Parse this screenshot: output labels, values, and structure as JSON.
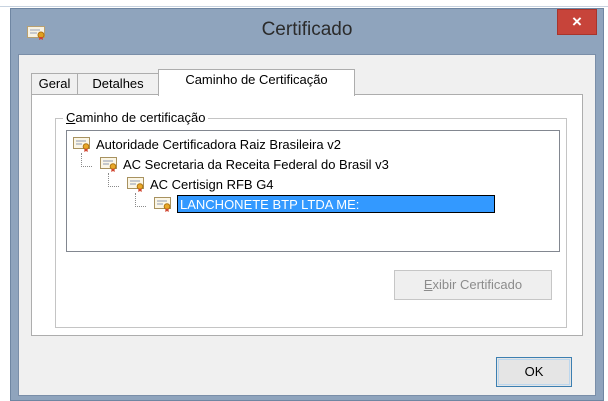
{
  "window": {
    "title": "Certificado",
    "close_glyph": "×"
  },
  "tabs": [
    {
      "label": "Geral",
      "active": false
    },
    {
      "label": "Detalhes",
      "active": false
    },
    {
      "label": "Caminho de Certificação",
      "active": true
    }
  ],
  "group": {
    "legend_accesskey": "C",
    "legend_rest": "aminho de certificação"
  },
  "tree": [
    {
      "label": "Autoridade Certificadora Raiz Brasileira v2",
      "level": 0,
      "selected": false
    },
    {
      "label": "AC Secretaria da Receita Federal do Brasil v3",
      "level": 1,
      "selected": false
    },
    {
      "label": "AC Certisign RFB G4",
      "level": 2,
      "selected": false
    },
    {
      "label": "LANCHONETE BTP LTDA ME:",
      "level": 3,
      "selected": true
    }
  ],
  "buttons": {
    "view_cert_accesskey": "E",
    "view_cert_rest": "xibir Certificado",
    "view_cert_enabled": false,
    "ok": "OK"
  },
  "colors": {
    "accent": "#3399ff",
    "close": "#c7443a",
    "window_frame": "#8fa4bd"
  },
  "icons": {
    "app": "certificate-icon",
    "tree_item": "certificate-icon"
  }
}
